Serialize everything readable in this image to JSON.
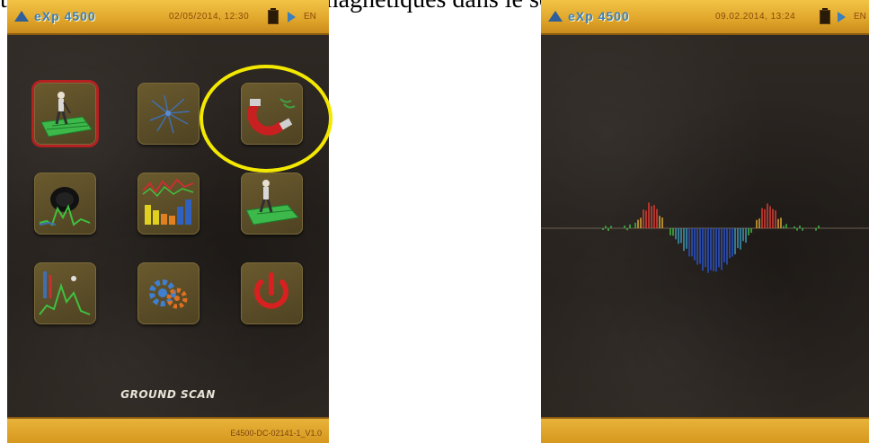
{
  "caption": {
    "text": "t d'identifier les matériaux ferromagnétiques dans le sol."
  },
  "left_screen": {
    "header": {
      "brand": "eXp 4500",
      "datetime": "02/05/2014, 12:30",
      "language": "EN"
    },
    "menu": {
      "tiles": [
        {
          "name": "ground-scan-mode-button",
          "icon": "walking-person-on-grid-icon",
          "selected": true
        },
        {
          "name": "discrimination-mode-button",
          "icon": "radar-burst-icon",
          "selected": false
        },
        {
          "name": "magnetometer-mode-button",
          "icon": "horseshoe-magnet-icon",
          "selected": false
        },
        {
          "name": "tunnel-scan-mode-button",
          "icon": "cavity-wave-icon",
          "selected": false
        },
        {
          "name": "live-stream-mode-button",
          "icon": "bar-graph-icon",
          "selected": false
        },
        {
          "name": "ground-scan-2-mode-button",
          "icon": "walking-person-on-grid-icon",
          "selected": false
        },
        {
          "name": "pinpointer-mode-button",
          "icon": "signal-peak-icon",
          "selected": false
        },
        {
          "name": "settings-button",
          "icon": "gear-icon",
          "selected": false
        },
        {
          "name": "power-off-button",
          "icon": "power-icon",
          "selected": false
        }
      ],
      "mode_label": "GROUND SCAN"
    },
    "footer": {
      "version": "E4500-DC-02141-1_V1.0"
    }
  },
  "right_screen": {
    "header": {
      "brand": "eXp 4500",
      "datetime": "09.02.2014, 13:24",
      "language": "EN"
    }
  },
  "colors": {
    "bar_yellow": "#e0a52a",
    "background_dark": "#2b2622",
    "highlight_circle": "#f3e800",
    "selected_red": "#b52020"
  }
}
